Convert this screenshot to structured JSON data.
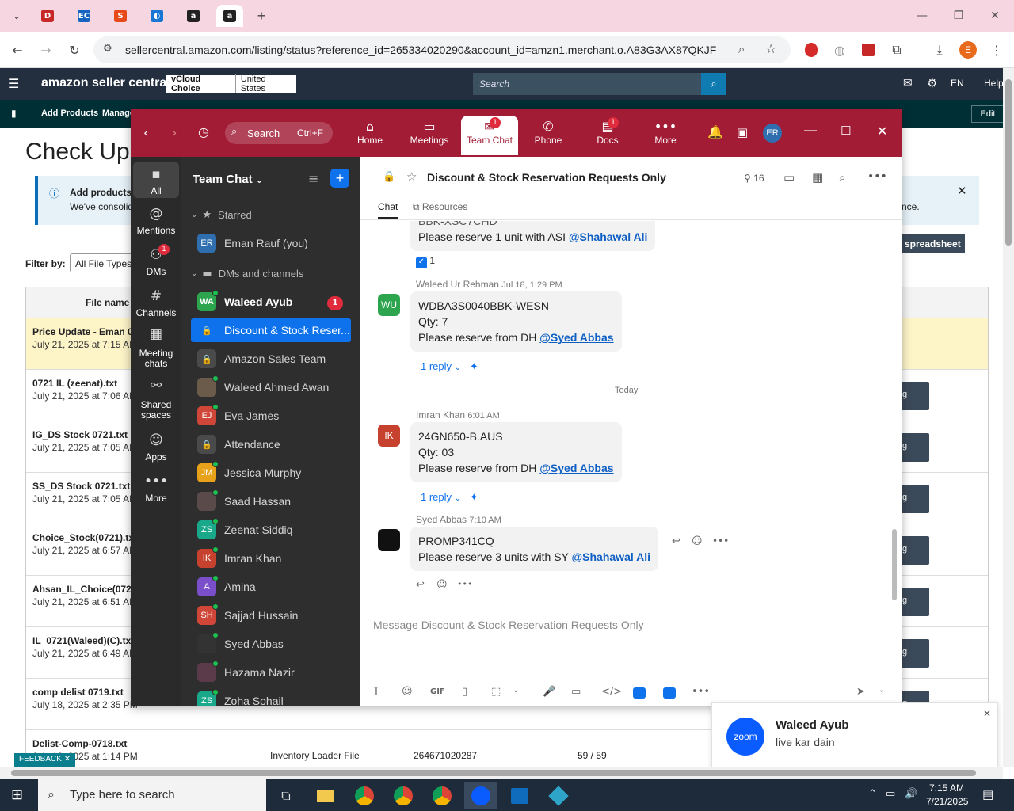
{
  "browser": {
    "tabs": [
      {
        "name": "dsi",
        "letter": "DSI",
        "color": "#c62828"
      },
      {
        "name": "ec",
        "letter": "EC",
        "color": "#1565c0"
      },
      {
        "name": "s",
        "letter": "S",
        "color": "#e64a19"
      },
      {
        "name": "cloud",
        "letter": "↻",
        "color": "#1976d2"
      },
      {
        "name": "amazon1",
        "letter": "a",
        "color": "#222"
      },
      {
        "name": "amazon2",
        "letter": "a",
        "color": "#222"
      }
    ],
    "url": "sellercentral.amazon.com/listing/status?reference_id=265334020290&account_id=amzn1.merchant.o.A83G3AX87QKJF",
    "profile_initial": "E"
  },
  "amazon": {
    "logo": "amazon seller central",
    "store_name": "vCloud Choice",
    "marketplace": "United States",
    "search_placeholder": "Search",
    "lang": "EN",
    "help": "Help",
    "nav_add_products": "Add Products",
    "nav_manage": "Manage",
    "edit": "Edit",
    "page_title": "Check Upl",
    "info_title": "Add products",
    "info_body": "We've consolid",
    "info_tail": "nce.",
    "spreadsheet_btn": "spreadsheet",
    "filter_label": "Filter by:",
    "filter_value": "All File Types",
    "col_file_name": "File name /",
    "feedback": "FEEDBACK",
    "files": [
      {
        "name": "Price Update - Eman 07",
        "date": "July 21, 2025 at 7:15 AM"
      },
      {
        "name": "0721 IL (zeenat).txt",
        "date": "July 21, 2025 at 7:06 AM"
      },
      {
        "name": "IG_DS Stock 0721.txt",
        "date": "July 21, 2025 at 7:05 AM"
      },
      {
        "name": "SS_DS Stock 0721.txt",
        "date": "July 21, 2025 at 7:05 AM"
      },
      {
        "name": "Choice_Stock(0721).txt",
        "date": "July 21, 2025 at 6:57 AM"
      },
      {
        "name": "Ahsan_IL_Choice(0721)",
        "date": "July 21, 2025 at 6:51 AM"
      },
      {
        "name": "IL_0721(Waleed)(C).txt",
        "date": "July 21, 2025 at 6:49 AM"
      },
      {
        "name": "comp delist 0719.txt",
        "date": "July 18, 2025 at 2:35 PM"
      },
      {
        "name": "Delist-Comp-0718.txt",
        "date": "July 18, 2025 at 1:14 PM"
      }
    ],
    "last_row_type": "Inventory Loader File",
    "last_row_id": "264671020287",
    "last_row_count": "59 / 59",
    "btn_stub": "g"
  },
  "zoom": {
    "search_label": "Search",
    "search_shortcut": "Ctrl+F",
    "tabs": [
      {
        "label": "Home",
        "icon": "⌂"
      },
      {
        "label": "Meetings",
        "icon": "▭"
      },
      {
        "label": "Team Chat",
        "icon": "💬",
        "badge": "1"
      },
      {
        "label": "Phone",
        "icon": "✆"
      },
      {
        "label": "Docs",
        "icon": "▤",
        "badge": "1"
      },
      {
        "label": "More",
        "icon": "•••"
      }
    ],
    "user_initials": "ER",
    "rail": [
      {
        "label": "All",
        "icon": "▪"
      },
      {
        "label": "Mentions",
        "icon": "@"
      },
      {
        "label": "DMs",
        "icon": "👥",
        "badge": "1"
      },
      {
        "label": "Channels",
        "icon": "#"
      },
      {
        "label": "Meeting chats",
        "icon": "▦"
      },
      {
        "label": "Shared spaces",
        "icon": "⚯"
      },
      {
        "label": "Apps",
        "icon": "☺"
      },
      {
        "label": "More",
        "icon": "•••"
      }
    ],
    "sidebar_title": "Team Chat",
    "section_starred": "Starred",
    "section_dms": "DMs and channels",
    "starred": [
      {
        "name": "Eman Rauf (you)",
        "initials": "ER",
        "color": "#2f6fb0"
      }
    ],
    "contacts": [
      {
        "name": "Waleed Ayub",
        "initials": "WA",
        "color": "#2da44e",
        "unread": "1",
        "bold": true
      },
      {
        "name": "Discount & Stock Reser...",
        "initials": "🔒",
        "color": "#0e72ed",
        "selected": true
      },
      {
        "name": "Amazon Sales Team",
        "initials": "🔒",
        "color": "#4a4a4a"
      },
      {
        "name": "Waleed Ahmed Awan",
        "initials": "",
        "color": "#6b5b4b"
      },
      {
        "name": "Eva James",
        "initials": "EJ",
        "color": "#d0473a"
      },
      {
        "name": "Attendance",
        "initials": "🔒",
        "color": "#4a4a4a"
      },
      {
        "name": "Jessica Murphy",
        "initials": "JM",
        "color": "#e8a21a"
      },
      {
        "name": "Saad Hassan",
        "initials": "",
        "color": "#5a4a4a"
      },
      {
        "name": "Zeenat Siddiq",
        "initials": "ZS",
        "color": "#1aa88a"
      },
      {
        "name": "Imran Khan",
        "initials": "IK",
        "color": "#c7412f"
      },
      {
        "name": "Amina",
        "initials": "A",
        "color": "#7b4fc9"
      },
      {
        "name": "Sajjad Hussain",
        "initials": "SH",
        "color": "#d0473a"
      },
      {
        "name": "Syed Abbas",
        "initials": "",
        "color": "#333"
      },
      {
        "name": "Hazama Nazir",
        "initials": "",
        "color": "#5b3a4a"
      },
      {
        "name": "Zoha Sohail",
        "initials": "ZS",
        "color": "#1aa88a"
      }
    ],
    "channel_title": "Discount & Stock Reservation Requests Only",
    "member_count": "16",
    "chan_tab_chat": "Chat",
    "chan_tab_resources": "Resources",
    "top_msg_line": "Please reserve 1 unit with ASI ",
    "top_msg_mention": "@Shahawal Ali",
    "top_msg_cut": "BBK-XSC7CHD",
    "reaction_count": "1",
    "messages": [
      {
        "author": "Waleed Ur Rehman",
        "time": "Jul 18, 1:29 PM",
        "initials": "WU",
        "color": "#2da44e",
        "l1": "WDBA3S0040BBK-WESN",
        "l2": "Qty: 7",
        "l3": "Please reserve from DH ",
        "mention": "@Syed Abbas",
        "reply": "1 reply"
      },
      {
        "author": "Imran Khan",
        "time": "6:01 AM",
        "initials": "IK",
        "color": "#c7412f",
        "l1": "24GN650-B.AUS",
        "l2": "Qty: 03",
        "l3": "Please reserve from DH ",
        "mention": "@Syed Abbas",
        "reply": "1 reply"
      },
      {
        "author": "Syed Abbas",
        "time": "7:10 AM",
        "l1": "PROMP341CQ",
        "l3": "Please reserve 3 units with SY ",
        "mention": "@Shahawal Ali"
      }
    ],
    "day_divider": "Today",
    "composer_placeholder": "Message Discount & Stock Reservation Requests Only"
  },
  "notification": {
    "app": "zoom",
    "title": "Waleed Ayub",
    "body": "live kar dain"
  },
  "taskbar": {
    "search_placeholder": "Type here to search",
    "time": "7:15 AM",
    "date": "7/21/2025"
  }
}
